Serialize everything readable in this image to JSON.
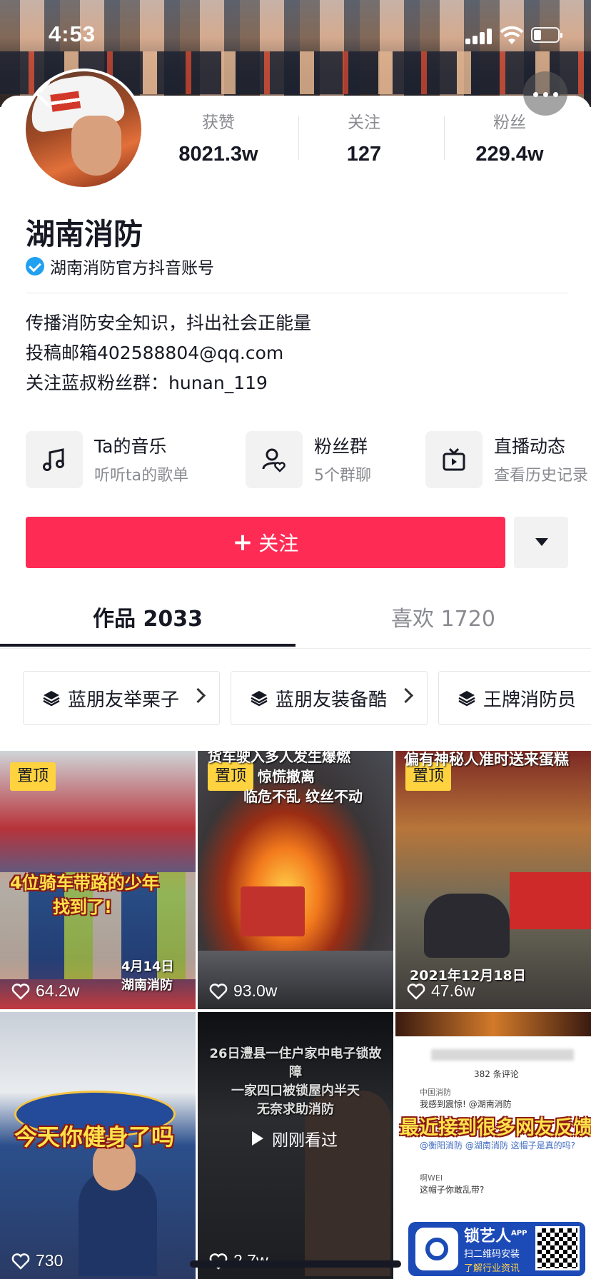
{
  "status_bar": {
    "time": "4:53"
  },
  "profile": {
    "name": "湖南消防",
    "verified_label": "湖南消防官方抖音账号",
    "stats": [
      {
        "label": "获赞",
        "value": "8021.3w"
      },
      {
        "label": "关注",
        "value": "127"
      },
      {
        "label": "粉丝",
        "value": "229.4w"
      }
    ],
    "bio": [
      "传播消防安全知识，抖出社会正能量",
      "投稿邮箱402588804@qq.com",
      "关注蓝叔粉丝群：hunan_119"
    ]
  },
  "features": [
    {
      "icon": "music-note-icon",
      "title": "Ta的音乐",
      "subtitle": "听听ta的歌单"
    },
    {
      "icon": "fan-group-icon",
      "title": "粉丝群",
      "subtitle": "5个群聊"
    },
    {
      "icon": "tv-icon",
      "title": "直播动态",
      "subtitle": "查看历史记录"
    }
  ],
  "actions": {
    "follow_label": "关注",
    "follow_plus": "+"
  },
  "colors": {
    "brand": "#fe2c55",
    "pin": "#fed33f",
    "verify": "#20a0f0"
  },
  "tabs": [
    {
      "label": "作品 2033",
      "active": true
    },
    {
      "label": "喜欢 1720",
      "active": false
    }
  ],
  "collections": [
    {
      "label": "蓝朋友举栗子"
    },
    {
      "label": "蓝朋友装备酷"
    },
    {
      "label": "王牌消防员"
    }
  ],
  "videos": [
    {
      "pinned": "置顶",
      "likes": "64.2w",
      "caption_lines": [
        "4位骑车带路的少年",
        "找到了!"
      ],
      "stamp": "4月14日 湖南消防"
    },
    {
      "pinned": "置顶",
      "likes": "93.0w",
      "caption_lines": [
        "货车驶入多人发生爆燃",
        "惊慌撤离",
        "临危不乱 纹丝不动"
      ]
    },
    {
      "pinned": "置顶",
      "likes": "47.6w",
      "caption_lines": [
        "偏有神秘人准时送来蛋糕"
      ],
      "stamp": "2021年12月18日"
    },
    {
      "likes": "730",
      "caption_lines": [
        "今天你健身了吗"
      ]
    },
    {
      "likes": "2.7w",
      "caption_lines": [
        "26日澧县一住户家中电子锁故障",
        "一家四口被锁屋内半天",
        "无奈求助消防"
      ],
      "overlay": "刚刚看过"
    },
    {
      "caption_lines": [
        "最近接到很多网友反馈"
      ],
      "comment_count": "382 条评论",
      "comments": [
        {
          "user": "中国消防",
          "text": "我感到震惊! @湖南消防"
        },
        {
          "user": "",
          "text": "@衡阳消防 @湖南消防  这帽子是真的吗?"
        },
        {
          "user": "啊WEI",
          "text": "这帽子你敢乱带?"
        }
      ]
    }
  ],
  "ad": {
    "title": "锁艺人",
    "title_sup": "APP",
    "line1": "扫二维码安装",
    "line2": "了解行业资讯"
  }
}
